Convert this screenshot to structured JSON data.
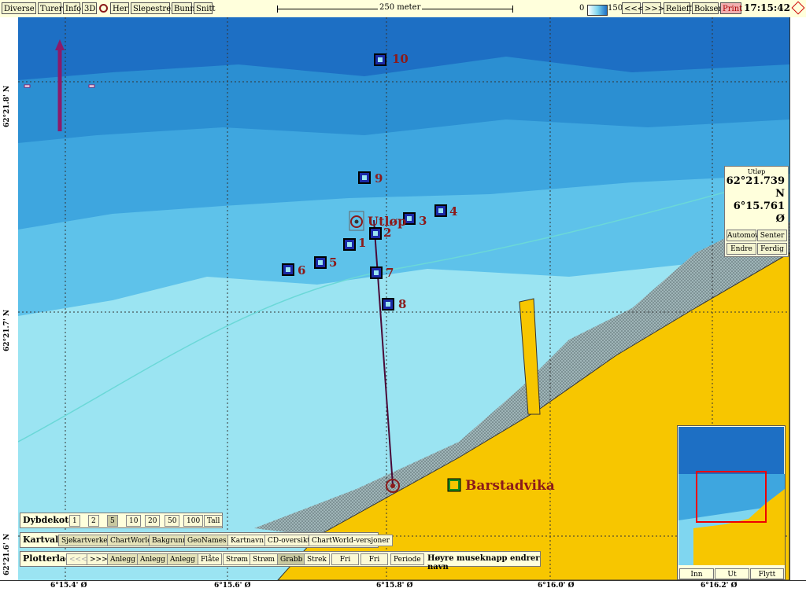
{
  "toolbar": {
    "buttons": [
      "Diverse",
      "Turer",
      "Info",
      "3D",
      "Her",
      "Slepestrek",
      "Bunn",
      "Snitt"
    ],
    "scale_label": "250 meter",
    "depth_min": "0",
    "depth_max": "150",
    "nav_prev": "<<<",
    "nav_next": ">>>",
    "relieff": "Relieff",
    "bokser": "Bokser",
    "print": "Print",
    "time": "17:15:42"
  },
  "map": {
    "lat_labels": [
      "62°21.8' N",
      "62°21.7' N",
      "62°21.6' N"
    ],
    "lon_labels": [
      "6°15.4' Ø",
      "6°15.6' Ø",
      "6°15.8' Ø",
      "6°16.0' Ø",
      "6°16.2' Ø"
    ],
    "waypoints": [
      "1",
      "2",
      "3",
      "4",
      "5",
      "6",
      "7",
      "8",
      "9",
      "10"
    ],
    "utlop_label": "Utløp",
    "place_label": "Barstadvika"
  },
  "position_box": {
    "title": "Utløp",
    "lat": "62°21.739 N",
    "lon": "6°15.761 Ø",
    "buttons": [
      "Automov",
      "Senter",
      "Endre",
      "Ferdig"
    ]
  },
  "depth_contours": {
    "label": "Dybdekoter",
    "options": [
      "1",
      "2",
      "5",
      "10",
      "20",
      "50",
      "100",
      "Tall"
    ],
    "selected": "5"
  },
  "kartvalg": {
    "label": "Kartvalg",
    "options": [
      "Sjøkartverket",
      "ChartWorld",
      "Bakgrunn",
      "GeoNames",
      "Kartnavn",
      "CD-oversikt",
      "ChartWorld-versjoner"
    ]
  },
  "plotterlag": {
    "label": "Plotterlag",
    "options": [
      "<<<",
      ">>>",
      "Anlegg",
      "Anlegg",
      "Anlegg",
      "Flåte",
      "Strøm",
      "Strøm",
      "Grabb",
      "Strek",
      "Fri",
      "Fri",
      "Periode"
    ],
    "hint": "Høyre museknapp endrer navn"
  },
  "minimap": {
    "buttons": [
      "Inn",
      "Ut",
      "Flytt"
    ]
  },
  "colors": {
    "toolbar_bg": "#ffffdc",
    "deep_water": "#1d6fc4",
    "shallow_water": "#9be4f2",
    "land": "#f7c600",
    "waypoint": "#1b2aa8",
    "label_red": "#8b1a1a"
  }
}
